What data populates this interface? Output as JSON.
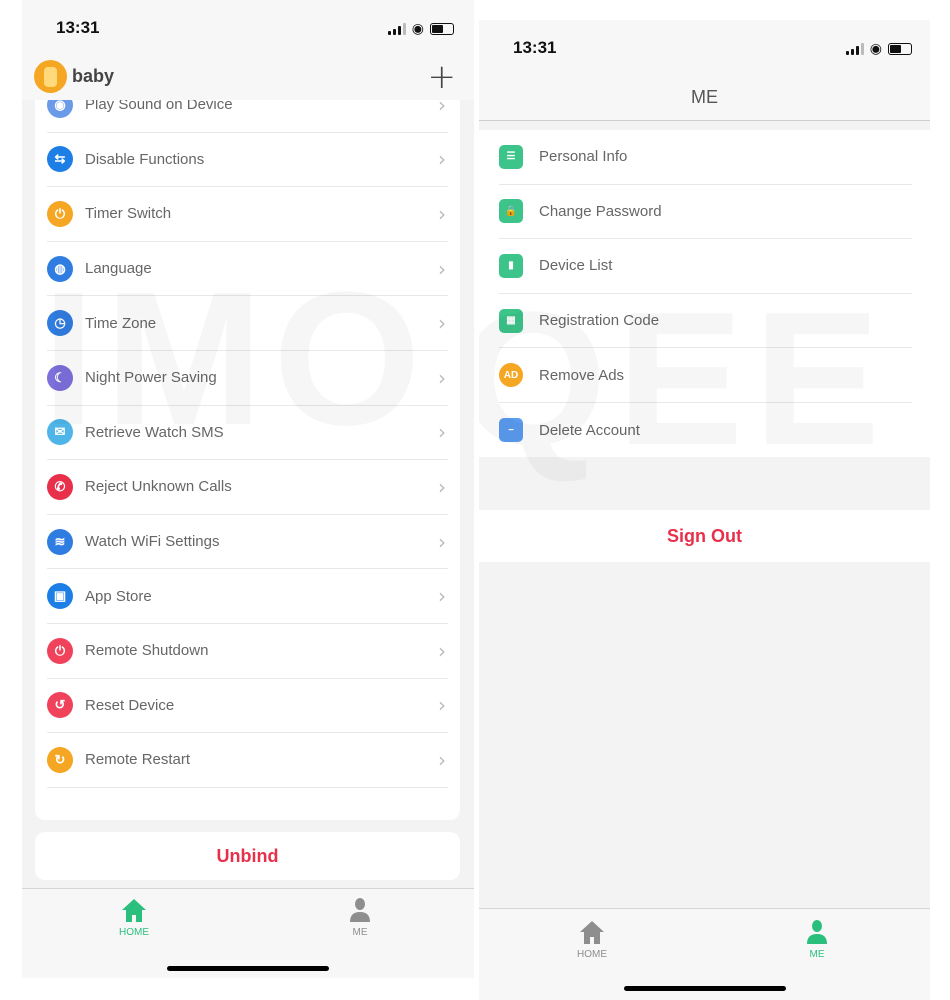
{
  "colors": {
    "accent": "#2bbf7e",
    "danger": "#e8304a",
    "inactive": "#8e8e8e"
  },
  "watermark": "IMOQEE",
  "left": {
    "status": {
      "time": "13:31"
    },
    "header": {
      "device_name": "baby",
      "add_icon": "plus-icon"
    },
    "menu": [
      {
        "label": "Play Sound on Device",
        "icon": "speaker-icon",
        "color": "#6b9be8"
      },
      {
        "label": "Disable Functions",
        "icon": "toggle-icon",
        "color": "#1d7fe6"
      },
      {
        "label": "Timer Switch",
        "icon": "timer-power-icon",
        "color": "#f5a623"
      },
      {
        "label": "Language",
        "icon": "globe-icon",
        "color": "#2f7de1"
      },
      {
        "label": "Time Zone",
        "icon": "clock-icon",
        "color": "#2f7de1"
      },
      {
        "label": "Night Power Saving",
        "icon": "moon-icon",
        "color": "#7d6fdc"
      },
      {
        "label": "Retrieve Watch SMS",
        "icon": "message-icon",
        "color": "#4fb4e8"
      },
      {
        "label": "Reject Unknown Calls",
        "icon": "phone-reject-icon",
        "color": "#e8304a"
      },
      {
        "label": "Watch WiFi Settings",
        "icon": "wifi-icon",
        "color": "#2f7de1"
      },
      {
        "label": "App Store",
        "icon": "shopping-bag-icon",
        "color": "#1d7fe6"
      },
      {
        "label": "Remote Shutdown",
        "icon": "power-icon",
        "color": "#f0425a"
      },
      {
        "label": "Reset Device",
        "icon": "reset-icon",
        "color": "#f0425a"
      },
      {
        "label": "Remote Restart",
        "icon": "watch-restart-icon",
        "color": "#f5a623"
      }
    ],
    "unbind_label": "Unbind",
    "tabs": [
      {
        "label": "HOME",
        "active": true
      },
      {
        "label": "ME",
        "active": false
      }
    ]
  },
  "right": {
    "status": {
      "time": "13:31"
    },
    "title": "ME",
    "menu": [
      {
        "label": "Personal Info",
        "icon": "id-card-icon",
        "color": "#3cc48a"
      },
      {
        "label": "Change Password",
        "icon": "lock-icon",
        "color": "#3cc48a"
      },
      {
        "label": "Device List",
        "icon": "watch-icon",
        "color": "#3cc48a"
      },
      {
        "label": "Registration Code",
        "icon": "qr-code-icon",
        "color": "#3cc48a"
      },
      {
        "label": "Remove Ads",
        "icon": "no-ads-icon",
        "color": "#f5a623"
      },
      {
        "label": "Delete Account",
        "icon": "user-remove-icon",
        "color": "#5b9bf0"
      }
    ],
    "sign_out_label": "Sign Out",
    "tabs": [
      {
        "label": "HOME",
        "active": false
      },
      {
        "label": "ME",
        "active": true
      }
    ]
  }
}
